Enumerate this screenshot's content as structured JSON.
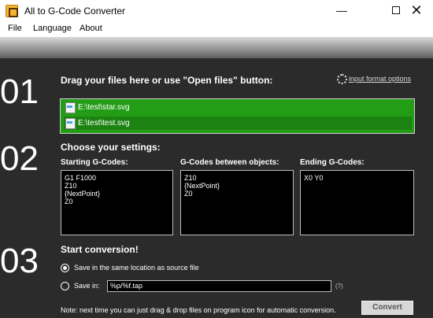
{
  "window": {
    "title": "All to G-Code Converter",
    "minimize_icon": "—",
    "close_icon": "✕"
  },
  "menu": {
    "items": [
      "File",
      "Language",
      "About"
    ]
  },
  "steps": {
    "one": {
      "number": "01",
      "title": "Drag your files here or use \"Open files\" button:"
    },
    "two": {
      "number": "02",
      "title": "Choose your settings:"
    },
    "three": {
      "number": "03",
      "title": "Start conversion!"
    }
  },
  "input_format_link": "input format options",
  "files": [
    "E:\\test\\star.svg",
    "E:\\test\\test.svg"
  ],
  "settings": {
    "start_label": "Starting G-Codes:",
    "start_value": "G1 F1000\nZ10\n{NextPoint}\nZ0",
    "between_label": "G-Codes between objects:",
    "between_value": "Z10\n{NextPoint}\nZ0",
    "end_label": "Ending G-Codes:",
    "end_value": "X0 Y0"
  },
  "conversion": {
    "same_location_label": "Save in the same location as source file",
    "save_in_label": "Save in:",
    "save_in_value": "%p/%f.tap",
    "help_label": "(?)",
    "note": "Note: next time you can just drag & drop files on program icon for automatic conversion.",
    "convert_label": "Convert"
  },
  "colors": {
    "accent_green": "#249d16",
    "background": "#2b2b2b",
    "text": "#ffffff"
  }
}
